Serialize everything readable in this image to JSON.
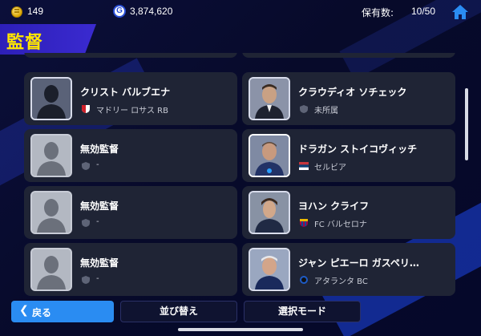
{
  "topbar": {
    "coins": "149",
    "gp_symbol": "G",
    "gp": "3,874,620",
    "holdings_label": "保有数:",
    "holdings_value": "10/50"
  },
  "page_title": "監督",
  "cards": [
    {
      "name": "クリスト バルブエナ",
      "team": "マドリー ロサス RB",
      "emblem": "red-white-crest"
    },
    {
      "name": "クラウディオ ソチェック",
      "team": "未所属",
      "emblem": "shield"
    },
    {
      "name": "無効監督",
      "team": "-",
      "emblem": "shield"
    },
    {
      "name": "ドラガン ストイコヴィッチ",
      "team": "セルビア",
      "emblem": "serbia-flag"
    },
    {
      "name": "無効監督",
      "team": "-",
      "emblem": "shield"
    },
    {
      "name": "ヨハン クライフ",
      "team": "FC バルセロナ",
      "emblem": "barcelona-crest"
    },
    {
      "name": "無効監督",
      "team": "-",
      "emblem": "shield"
    },
    {
      "name": "ジャン ピエーロ ガスペリ…",
      "team": "アタランタ BC",
      "emblem": "atalanta-crest"
    }
  ],
  "buttons": {
    "back": "戻る",
    "sort": "並び替え",
    "select_mode": "選択モード"
  },
  "colors": {
    "accent": "#2a8cf2",
    "title": "#ffe600",
    "card": "#1f2435"
  }
}
